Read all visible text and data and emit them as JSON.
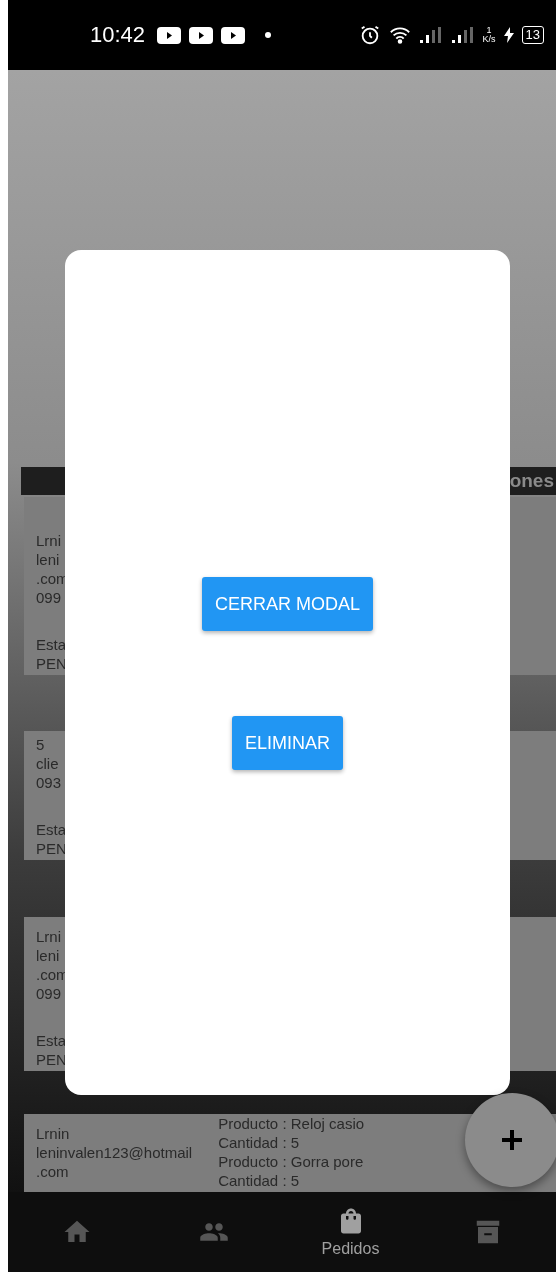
{
  "status_bar": {
    "time": "10:42",
    "speed_value": "1",
    "speed_unit": "K/s",
    "battery": "13"
  },
  "table": {
    "header": "ones",
    "rows": [
      {
        "client_lines": [
          "Lrni",
          "leni",
          ".com",
          "099"
        ],
        "status_lines": [
          "Esta",
          "PEN"
        ]
      },
      {
        "client_lines": [
          "5",
          "clie",
          "093"
        ],
        "status_lines": [
          "Esta",
          "PEN"
        ]
      },
      {
        "client_lines": [
          "Lrni",
          "leni",
          ".com",
          "099"
        ],
        "status_lines": [
          "Esta",
          "PEN"
        ]
      },
      {
        "client_lines": [
          "Lrnin",
          "leninvalen123@hotmail",
          ".com"
        ],
        "product_lines": [
          "Producto : Reloj casio",
          "Cantidad : 5",
          "Producto : Gorra pore",
          "Cantidad : 5"
        ]
      }
    ]
  },
  "modal": {
    "buttons": [
      {
        "label": "CERRAR MODAL"
      },
      {
        "label": "ELIMINAR"
      }
    ]
  },
  "nav": {
    "items": [
      {
        "kind": "home",
        "selected": false
      },
      {
        "kind": "people",
        "selected": false
      },
      {
        "kind": "bag",
        "label": "Pedidos",
        "selected": true
      },
      {
        "kind": "archive",
        "selected": false
      }
    ]
  }
}
